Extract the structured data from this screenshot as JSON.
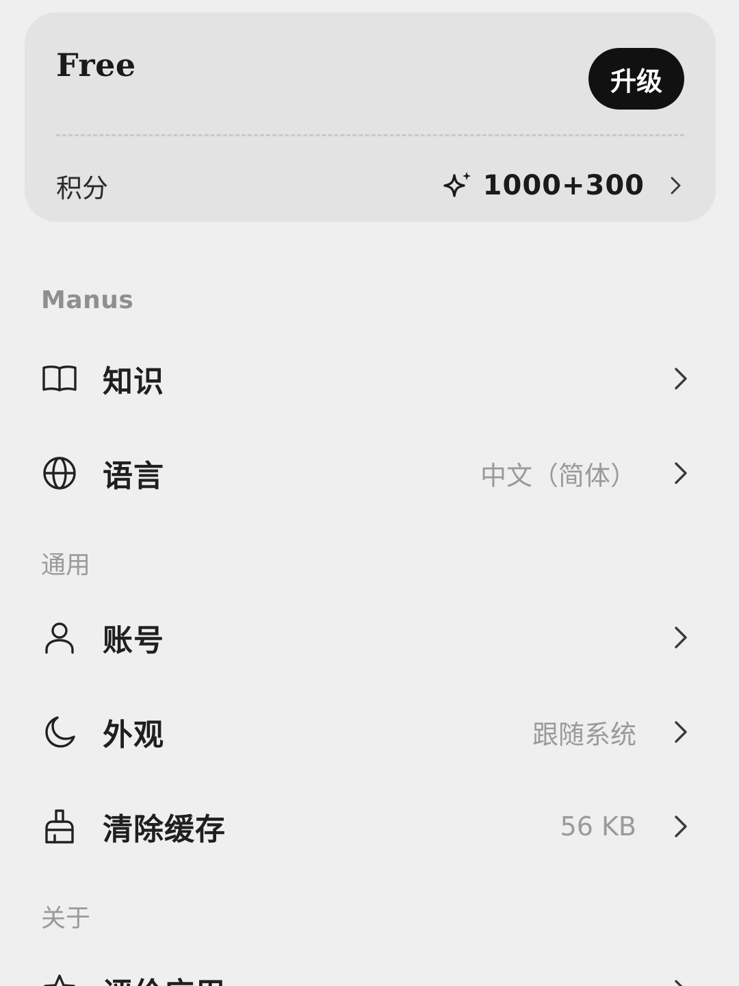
{
  "plan": {
    "name": "Free",
    "upgrade_label": "升级",
    "credits_label": "积分",
    "credits_value": "1000+300"
  },
  "sections": {
    "manus": {
      "title": "Manus",
      "items": [
        {
          "label": "知识",
          "value": "",
          "icon": "book-icon"
        },
        {
          "label": "语言",
          "value": "中文（简体）",
          "icon": "globe-icon"
        }
      ]
    },
    "general": {
      "title": "通用",
      "items": [
        {
          "label": "账号",
          "value": "",
          "icon": "user-icon"
        },
        {
          "label": "外观",
          "value": "跟随系统",
          "icon": "moon-icon"
        },
        {
          "label": "清除缓存",
          "value": "56 KB",
          "icon": "brush-icon"
        }
      ]
    },
    "about": {
      "title": "关于",
      "items": [
        {
          "label": "评价应用",
          "value": "",
          "icon": "star-icon"
        }
      ]
    }
  },
  "colors": {
    "background": "#efefef",
    "card": "#e3e3e3",
    "button": "#111111",
    "muted_text": "#9a9a9a"
  }
}
